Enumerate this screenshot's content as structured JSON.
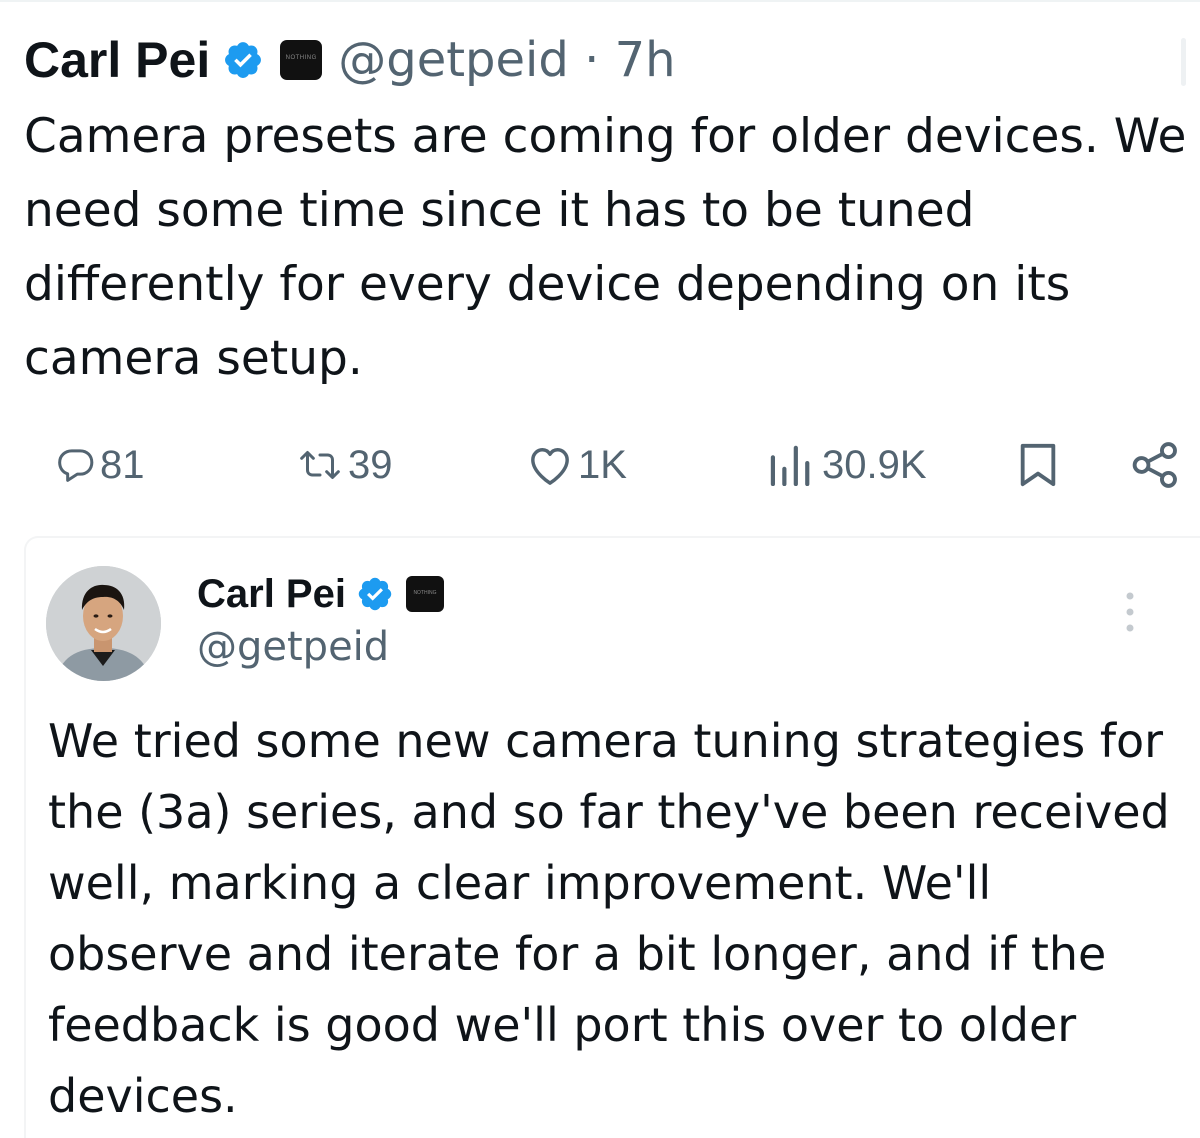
{
  "tweet": {
    "author_name": "Carl Pei",
    "affiliate_badge_text": "NOTHING",
    "meta": "@getpeid · 7h",
    "text": "Camera presets are coming for older devices. We need some time since it has to be tuned differently for every device depending on its camera setup.",
    "actions": {
      "replies": "81",
      "reposts": "39",
      "likes": "1K",
      "views": "30.9K"
    }
  },
  "quoted_tweet": {
    "author_name": "Carl Pei",
    "affiliate_badge_text": "NOTHING",
    "handle": "@getpeid",
    "text": "We tried some new camera tuning strategies for the (3a) series, and so far they've been received well, marking a clear improvement. We'll observe and iterate for a bit longer, and if the feedback is good we'll port this over to older devices."
  },
  "icons": {
    "verified": "verified-badge-icon",
    "reply": "reply-icon",
    "repost": "repost-icon",
    "like": "heart-icon",
    "views": "views-icon",
    "bookmark": "bookmark-icon",
    "share": "share-icon",
    "more": "more-icon"
  },
  "colors": {
    "verified_blue": "#1d9bf0",
    "text_primary": "#0f1419",
    "text_secondary": "#536471"
  }
}
